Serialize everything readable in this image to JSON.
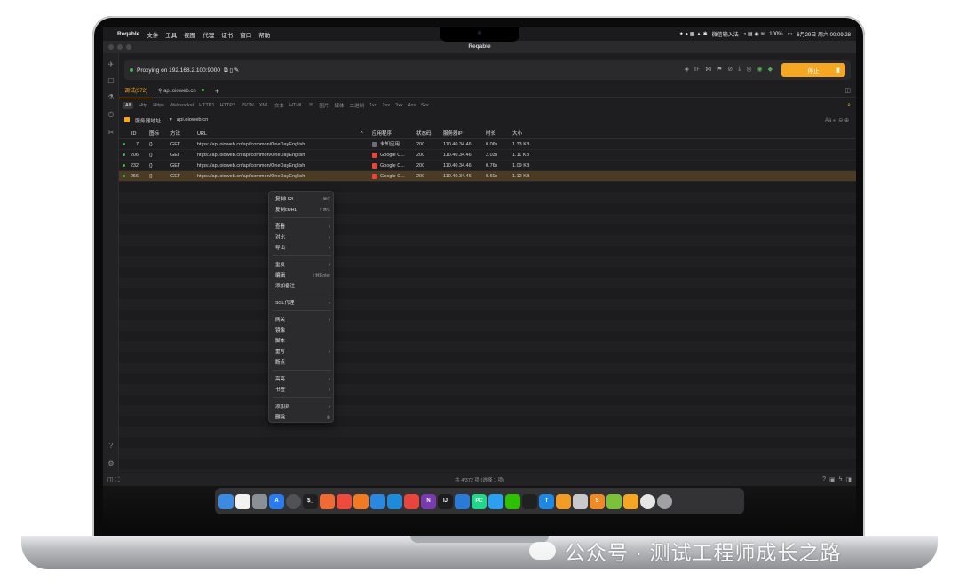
{
  "menubar": {
    "apple": "",
    "items": [
      "Reqable",
      "文件",
      "工具",
      "视图",
      "代理",
      "证书",
      "窗口",
      "帮助"
    ],
    "ime": "微信输入法",
    "battery": "100%",
    "datetime": "6月29日 周六 00:09:28"
  },
  "window": {
    "title": "Reqable"
  },
  "proxy": {
    "text": "Proxying on 192.168.2.100:9000",
    "stop_label": "停止"
  },
  "tabs": {
    "items": [
      "调试(372)",
      "api.oioweb.cn"
    ],
    "add": "+"
  },
  "filters": [
    "All",
    "Http",
    "Https",
    "Websocket",
    "HTTP1",
    "HTTP2",
    "JSON",
    "XML",
    "文本",
    "HTML",
    "JS",
    "图片",
    "媒体",
    "二进制",
    "1xx",
    "2xx",
    "3xx",
    "4xx",
    "5xx"
  ],
  "domain_filter": {
    "label": "服务器地址",
    "value": "api.oioweb.cn",
    "case": "Aa"
  },
  "table": {
    "headers": {
      "id": "ID",
      "icon": "图标",
      "method": "方法",
      "url": "URL",
      "sort": "^",
      "app": "应用程序",
      "status": "状态码",
      "server_ip": "服务器IP",
      "duration": "时长",
      "size": "大小"
    },
    "rows": [
      {
        "id": "7",
        "icon": "{}",
        "method": "GET",
        "url": "https://api.oioweb.cn/api/common/OneDayEnglish",
        "app": "未知应用",
        "app_color": "#6b6f7a",
        "status": "200",
        "server_ip": "110.40.34.46",
        "duration": "0.06s",
        "size": "1.33 KB"
      },
      {
        "id": "206",
        "icon": "{}",
        "method": "GET",
        "url": "https://api.oioweb.cn/api/common/OneDayEnglish",
        "app": "Google C...",
        "app_color": "#e8453c",
        "status": "200",
        "server_ip": "110.40.34.46",
        "duration": "2.03s",
        "size": "1.11 KB"
      },
      {
        "id": "232",
        "icon": "{}",
        "method": "GET",
        "url": "https://api.oioweb.cn/api/common/OneDayEnglish",
        "app": "Google C...",
        "app_color": "#e8453c",
        "status": "200",
        "server_ip": "110.40.34.46",
        "duration": "0.76s",
        "size": "1.09 KB"
      },
      {
        "id": "256",
        "icon": "{}",
        "method": "GET",
        "url": "https://api.oioweb.cn/api/common/OneDayEnglish",
        "app": "Google C...",
        "app_color": "#e8453c",
        "status": "200",
        "server_ip": "110.40.34.46",
        "duration": "0.60s",
        "size": "1.12 KB"
      }
    ]
  },
  "context_menu": {
    "copy_url": "复制URL",
    "copy_url_sc": "⌘C",
    "copy_curl": "复制cURL",
    "copy_curl_sc": "⇧⌘C",
    "view": "查看",
    "compare": "对比",
    "export": "导出",
    "replay": "重发",
    "edit": "编辑",
    "edit_sc": "⇧⌘Enter",
    "add_note": "添加备注",
    "ssl_proxy": "SSL代理",
    "gateway": "网关",
    "mirror": "镜像",
    "script": "脚本",
    "rewrite": "重写",
    "breakpoint": "断点",
    "highlight": "高亮",
    "bookmark": "书签",
    "add_to": "添加到",
    "delete": "删除"
  },
  "statusbar": {
    "text": "共 4/372 项 (选择 1 项)"
  },
  "dock": {
    "apps": [
      {
        "name": "finder",
        "color": "#3d8be0",
        "label": ""
      },
      {
        "name": "reminders",
        "color": "#f2f2f2",
        "label": ""
      },
      {
        "name": "launchpad",
        "color": "#8b8f96",
        "label": ""
      },
      {
        "name": "appstore",
        "color": "#2a7bf0",
        "label": "A"
      },
      {
        "name": "chatgpt",
        "color": "#505256",
        "label": ""
      },
      {
        "name": "terminal",
        "color": "#202020",
        "label": "$_"
      },
      {
        "name": "postman",
        "color": "#f06a33",
        "label": ""
      },
      {
        "name": "pencil",
        "color": "#ef4b3d",
        "label": ""
      },
      {
        "name": "firefox",
        "color": "#f27a22",
        "label": ""
      },
      {
        "name": "safari",
        "color": "#2b88e0",
        "label": ""
      },
      {
        "name": "edge",
        "color": "#1f8bd8",
        "label": ""
      },
      {
        "name": "chrome",
        "color": "#e8453c",
        "label": ""
      },
      {
        "name": "onenote",
        "color": "#7b3bb0",
        "label": "N"
      },
      {
        "name": "intellij",
        "color": "#1d1d1f",
        "label": "IJ"
      },
      {
        "name": "vscode",
        "color": "#2a7bd8",
        "label": ""
      },
      {
        "name": "pycharm",
        "color": "#21d789",
        "label": "PC"
      },
      {
        "name": "qq",
        "color": "#2aa0ef",
        "label": ""
      },
      {
        "name": "wechat",
        "color": "#2dc100",
        "label": ""
      },
      {
        "name": "qq-penguin",
        "color": "#202020",
        "label": ""
      },
      {
        "name": "tencent",
        "color": "#1e88e5",
        "label": "T"
      },
      {
        "name": "paw",
        "color": "#f29b27",
        "label": ""
      },
      {
        "name": "teapot",
        "color": "#c9c9cc",
        "label": ""
      },
      {
        "name": "sublime",
        "color": "#f08a24",
        "label": "S"
      },
      {
        "name": "notes",
        "color": "#7bc23a",
        "label": ""
      },
      {
        "name": "reqable",
        "color": "#f5a623",
        "label": ""
      },
      {
        "name": "downloads",
        "color": "#e6e6e6",
        "label": ""
      },
      {
        "name": "trash",
        "color": "#9fa1a5",
        "label": ""
      }
    ]
  },
  "watermark": {
    "text": "公众号 · 测试工程师成长之路"
  }
}
